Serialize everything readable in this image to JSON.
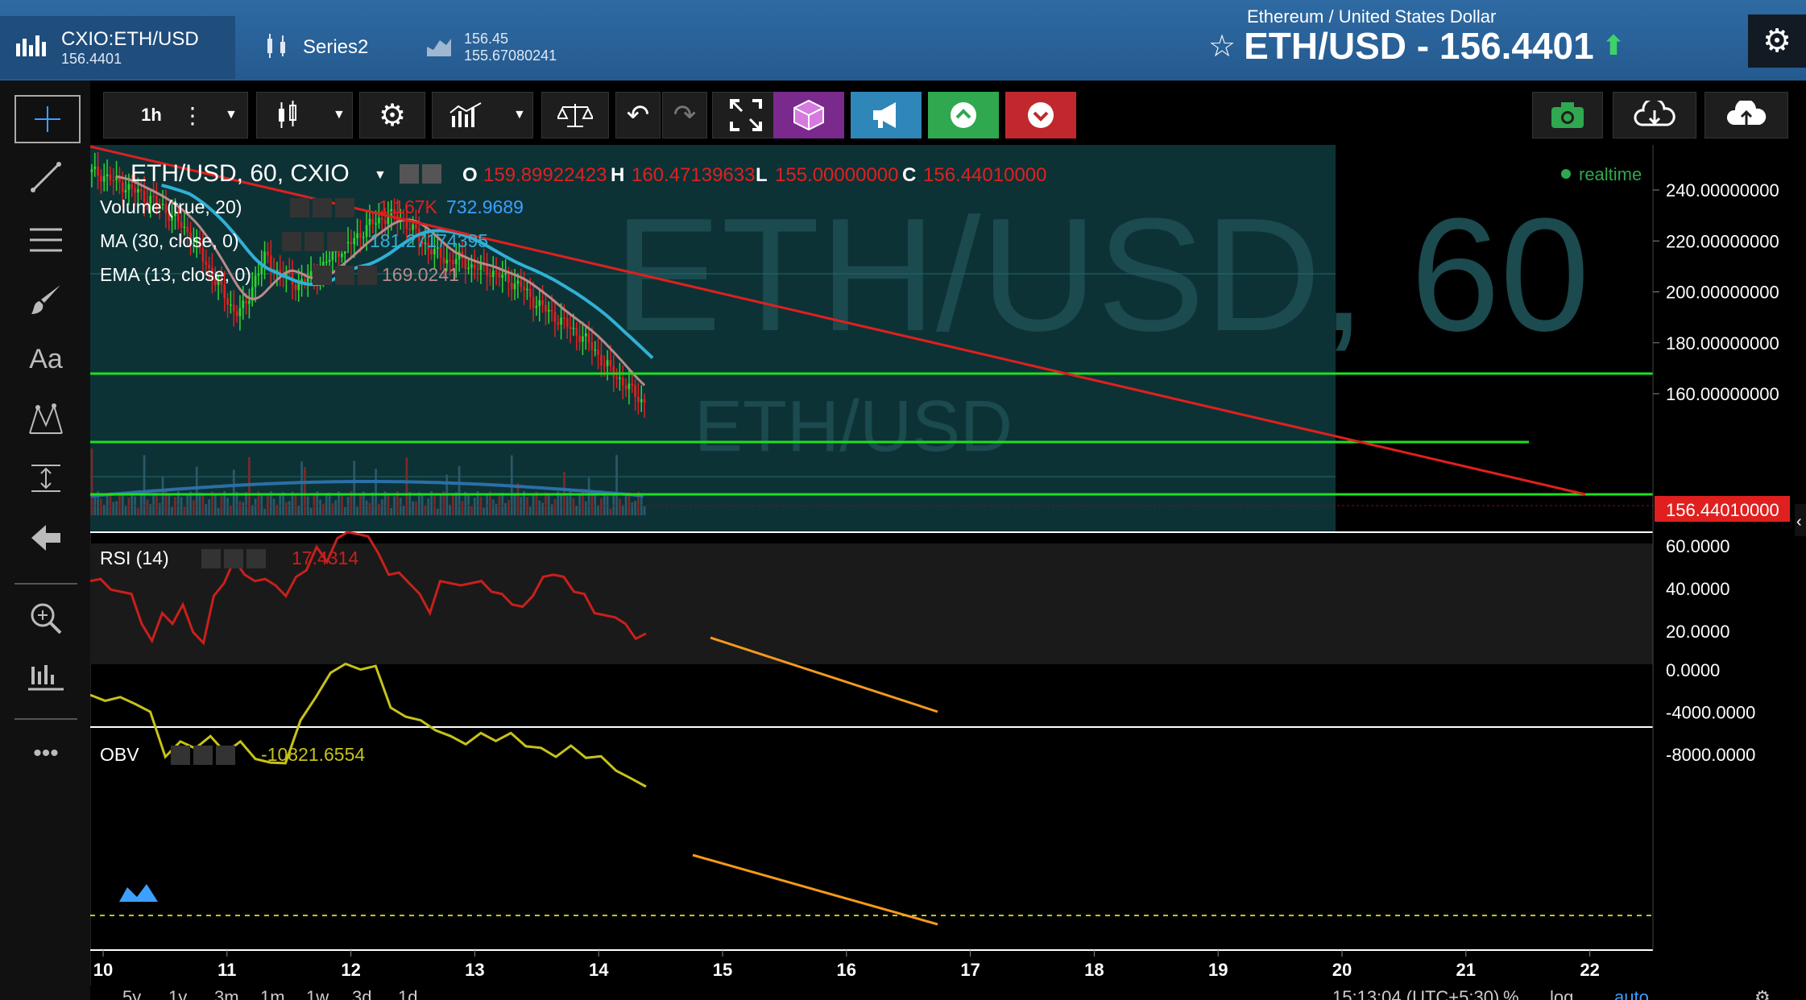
{
  "header": {
    "tabs": [
      {
        "name": "CXIO:ETH/USD",
        "sub": "156.4401"
      },
      {
        "name": "Series2",
        "sub": ""
      },
      {
        "name": "156.45",
        "sub": "155.67080241"
      }
    ],
    "pair_description": "Ethereum / United States Dollar",
    "pair_title": "ETH/USD - 156.4401",
    "colors": {
      "header_bg": "#2f6aa3",
      "up": "#3ed26a"
    }
  },
  "toolbar": {
    "interval": "1h",
    "buttons": [
      "crosshair-icon",
      "candles-icon",
      "settings-icon",
      "indicators-icon",
      "compare-icon",
      "undo-icon",
      "redo-icon",
      "fullscreen-icon",
      "cube-icon",
      "megaphone-icon",
      "arrow-up-icon",
      "arrow-down-icon",
      "camera-icon",
      "cloud-download-icon",
      "cloud-upload-icon"
    ]
  },
  "left_tools": [
    "crosshair-icon",
    "trend-line-icon",
    "horizontal-lines-icon",
    "brush-icon",
    "text-icon",
    "pattern-icon",
    "measure-icon",
    "back-arrow-icon",
    "zoom-icon",
    "chart-settings-icon",
    "more-icon"
  ],
  "legend": {
    "main": "ETH/USD, 60, CXIO",
    "o_label": "O",
    "o": "159.89922423",
    "h_label": "H",
    "h": "160.47139633",
    "l_label": "L",
    "l": "155.00000000",
    "c_label": "C",
    "c": "156.44010000",
    "volume": "Volume (true, 20)",
    "vol1": "1.167K",
    "vol2": "732.9689",
    "ma": "MA (30, close, 0)",
    "ma_val": "181.27174395",
    "ema": "EMA (13, close, 0)",
    "ema_val": "169.0241",
    "realtime": "realtime",
    "watermark": "ETH/USD, 60",
    "watermark_sub": "ETH/USD"
  },
  "rsi": {
    "label": "RSI (14)",
    "value": "17.4314"
  },
  "obv": {
    "label": "OBV",
    "value": "-10821.6554"
  },
  "price_axis": {
    "ticks": [
      "240.00000000",
      "220.00000000",
      "200.00000000",
      "180.00000000",
      "160.00000000"
    ],
    "current": "156.44010000",
    "current_color": "#e0201e"
  },
  "rsi_axis": {
    "ticks": [
      "60.0000",
      "40.0000",
      "20.0000"
    ]
  },
  "obv_axis": {
    "ticks": [
      "0.0000",
      "-4000.0000",
      "-8000.0000"
    ]
  },
  "time_axis": {
    "ticks": [
      "10",
      "11",
      "12",
      "13",
      "14",
      "15",
      "16",
      "17",
      "18",
      "19",
      "20",
      "21",
      "22"
    ]
  },
  "bottom_bar": {
    "ranges": [
      "5y",
      "1y",
      "3m",
      "1m",
      "1w",
      "3d",
      "1d"
    ],
    "time": "15:13:04 (UTC+5:30)",
    "pct": "%",
    "log": "log",
    "auto": "auto"
  },
  "chart_data": {
    "type": "candlestick",
    "symbol": "ETH/USD",
    "interval": "60",
    "price_range": [
      148,
      254
    ],
    "close_approx": [
      247,
      246,
      244,
      242,
      240,
      238,
      236,
      233,
      229,
      225,
      220,
      212,
      205,
      198,
      192,
      194,
      206,
      214,
      208,
      206,
      203,
      205,
      207,
      212,
      216,
      218,
      222,
      226,
      228,
      230,
      229,
      226,
      221,
      217,
      214,
      212,
      213,
      210,
      209,
      208,
      206,
      204,
      202,
      197,
      194,
      191,
      188,
      185,
      182,
      178,
      172,
      168,
      164,
      160,
      156.44
    ],
    "horizontal_lines": [
      192,
      174,
      160
    ],
    "trendline": {
      "from": [
        10,
        255
      ],
      "to": [
        22.05,
        161
      ]
    },
    "ma30_color": "#31b0d5",
    "ema13_color": "#b98a8a",
    "rsi_values": [
      42,
      46,
      38,
      40,
      36,
      25,
      14,
      30,
      22,
      34,
      18,
      16,
      35,
      44,
      52,
      48,
      42,
      46,
      40,
      38,
      44,
      50,
      58,
      54,
      62,
      68,
      64,
      66,
      55,
      48,
      46,
      44,
      36,
      30,
      42,
      44,
      40,
      44,
      42,
      40,
      36,
      34,
      30,
      38,
      44,
      48,
      44,
      40,
      36,
      30,
      26,
      28,
      22,
      18,
      17.43
    ],
    "obv_values": [
      -2600,
      -2700,
      -2800,
      -3000,
      -4200,
      -8000,
      -7000,
      -7200,
      -6500,
      -7600,
      -7000,
      -8200,
      -9000,
      -8600,
      -5000,
      -2400,
      -500,
      800,
      -200,
      600,
      -3800,
      -4200,
      -5000,
      -5500,
      -6500,
      -6800,
      -6200,
      -6500,
      -6200,
      -7000,
      -7600,
      -8000,
      -7400,
      -8100,
      -8400,
      -9300,
      -10500,
      -10821.66
    ]
  }
}
